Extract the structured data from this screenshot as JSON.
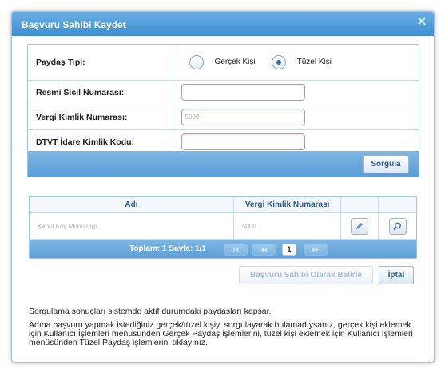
{
  "dialog": {
    "title": "Başvuru Sahibi Kaydet",
    "close_glyph": "✕"
  },
  "form": {
    "paydas_tipi_label": "Paydaş Tipi:",
    "radio_gercek": "Gerçek Kişi",
    "radio_tuzel": "Tüzel Kişi",
    "selected_radio": "Tüzel Kişi",
    "resmi_sicil_label": "Resmi Sicil Numarası:",
    "resmi_sicil_value": "",
    "vergi_kimlik_label": "Vergi Kimlik Numarası:",
    "vergi_kimlik_value": "5000",
    "dtvt_label": "DTVT İdare Kimlik Kodu:",
    "dtvt_value": "",
    "sorgula_label": "Sorgula"
  },
  "grid": {
    "headers": [
      "Adı",
      "Vergi Kimlik Numarası"
    ],
    "rows": [
      {
        "adi": "Kabul Köy Muhtarlığı",
        "vkn": "5000"
      }
    ],
    "pager_info": "Toplam: 1 Sayfa: 1/1",
    "first_glyph": "|◂",
    "prev_glyph": "◂◂",
    "current_page": "1",
    "next_glyph": "▸▸"
  },
  "actions": {
    "belirle_label": "Başvuru Sahibi Olarak Belirle",
    "iptal_label": "İptal"
  },
  "info": {
    "line1": "Sorgulama sonuçları sistemde aktif durumdaki paydaşları kapsar.",
    "line2": "Adına başvuru yapmak istediğiniz gerçek/tüzel kişiyi sorgulayarak bulamadıysanız, gerçek kişi eklemek için Kullanıcı İşlemleri menüsünden Gerçek Paydaş işlemlerini, tüzel kişi eklemek için Kullanıcı İşlemleri menüsünden Tüzel Paydaş işlemlerini tıklayınız."
  },
  "colors": {
    "title_bar": "#4a98d9",
    "accent": "#2c5a84",
    "border": "#9bc4e6"
  }
}
